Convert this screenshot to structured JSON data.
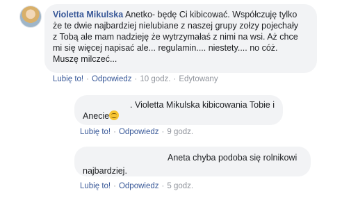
{
  "main_comment": {
    "author": "Violetta Mikulska",
    "lines": [
      "Anetko- będę Ci kibicować. Współczuję tylko",
      "że te dwie najbardziej nielubiane z naszej grupy zołzy pojechały",
      "z Tobą ale mam nadzieję że wytrzymałaś z nimi na wsi. Aż chce",
      "mi się więcej napisać ale... regulamin.... niestety.... no cóż.",
      "Muszę milczeć..."
    ],
    "actions": {
      "like": "Lubię to!",
      "reply": "Odpowiedz",
      "time": "10 godz.",
      "edited": "Edytowany"
    }
  },
  "replies": [
    {
      "prefix": ".",
      "lines": [
        "Violetta Mikulska kibicowania Tobie i",
        "Anecie"
      ],
      "emoji": "smiling-face-emoji",
      "actions": {
        "like": "Lubię to!",
        "reply": "Odpowiedz",
        "time": "9 godz."
      }
    },
    {
      "lines": [
        "Aneta chyba podoba się rolnikowi",
        "najbardziej."
      ],
      "actions": {
        "like": "Lubię to!",
        "reply": "Odpowiedz",
        "time": "5 godz."
      }
    }
  ],
  "separator": "·"
}
